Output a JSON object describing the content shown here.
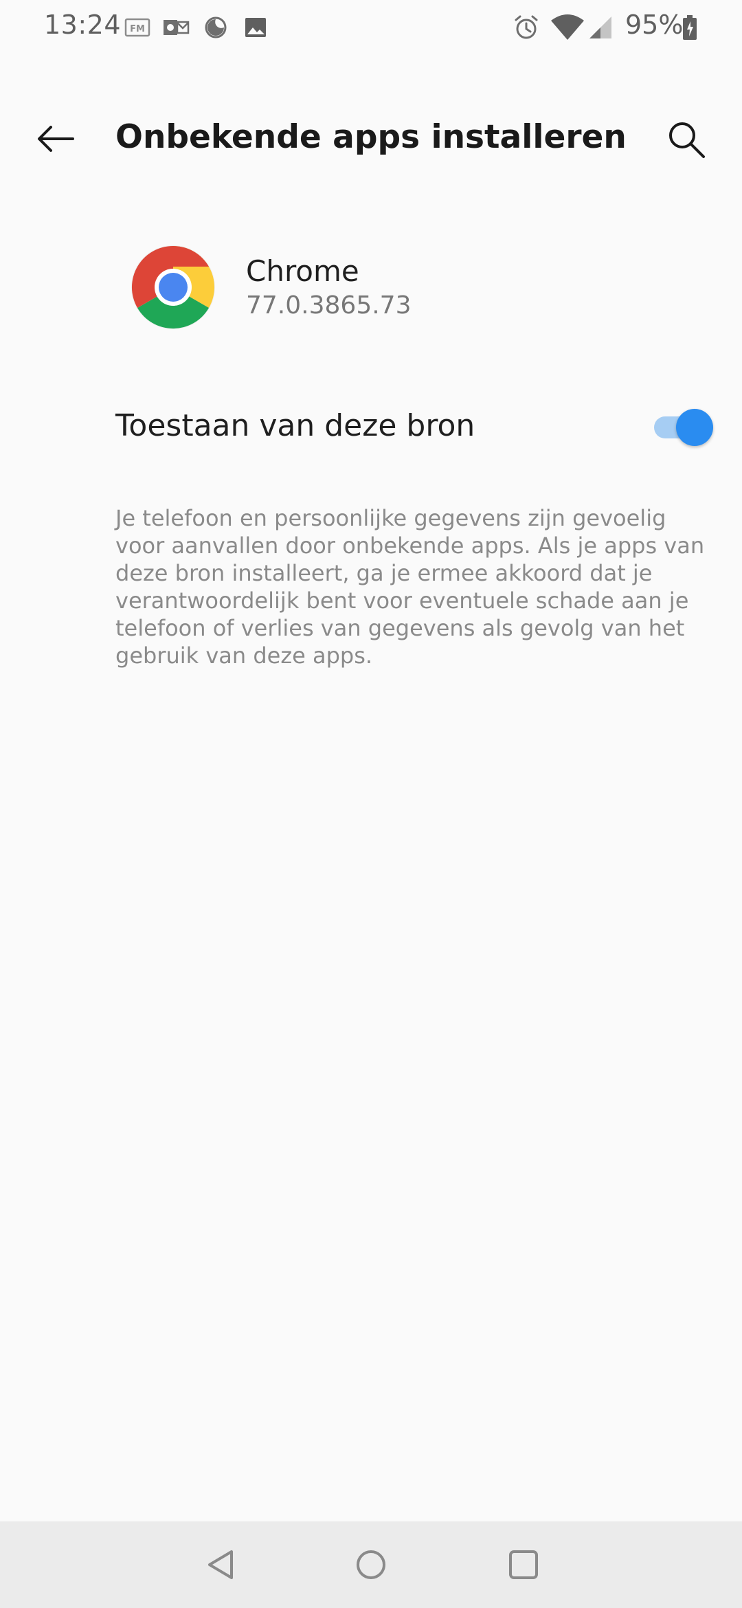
{
  "status_bar": {
    "time": "13:24",
    "battery_percent": "95%",
    "left_icons": [
      "fm-radio-icon",
      "outlook-icon",
      "night-mode-icon",
      "gallery-icon"
    ],
    "right_icons": [
      "alarm-icon",
      "wifi-icon",
      "cell-signal-icon",
      "battery-icon"
    ]
  },
  "header": {
    "title": "Onbekende apps installeren",
    "back_icon": "arrow-back-icon",
    "search_icon": "search-icon"
  },
  "app": {
    "name": "Chrome",
    "version": "77.0.3865.73",
    "icon": "chrome-icon"
  },
  "setting": {
    "label": "Toestaan van deze bron",
    "enabled": true,
    "accent_color": "#2a8cf0"
  },
  "warning": {
    "text": "Je telefoon en persoonlijke gegevens zijn gevoelig voor aanvallen door onbekende apps. Als je apps van deze bron installeert, ga je ermee akkoord dat je verantwoordelijk bent voor eventuele schade aan je telefoon of verlies van gegevens als gevolg van het gebruik van deze apps."
  },
  "nav_bar": {
    "buttons": [
      "back-nav-icon",
      "home-nav-icon",
      "recents-nav-icon"
    ]
  }
}
